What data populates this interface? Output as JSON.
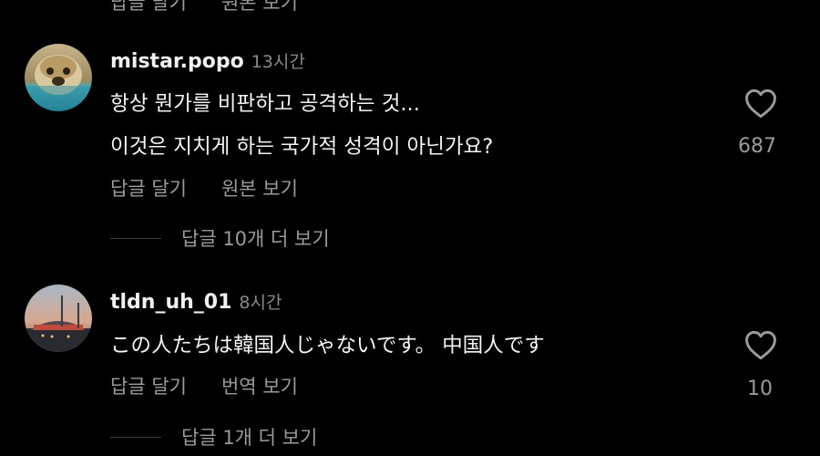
{
  "top_actions": {
    "reply": "답글 달기",
    "original": "원본 보기"
  },
  "comments": [
    {
      "username": "mistar.popo",
      "time": "13시간",
      "lines": [
        "항상 뭔가를 비판하고 공격하는 것...",
        "이것은 지치게 하는 국가적 성격이 아닌가요?"
      ],
      "likes": "687",
      "reply_label": "답글 달기",
      "secondary_label": "원본 보기",
      "view_replies": "답글 10개 더 보기"
    },
    {
      "username": "tldn_uh_01",
      "time": "8시간",
      "lines": [
        "この人たちは韓国人じゃないです。 中国人です"
      ],
      "likes": "10",
      "reply_label": "답글 달기",
      "secondary_label": "번역 보기",
      "view_replies": "답글 1개 더 보기"
    }
  ],
  "colors": {
    "background": "#000000",
    "primary_text": "#f5f5f5",
    "secondary_text": "#9a9a9a"
  },
  "icons": {
    "like": "heart-outline-icon"
  }
}
